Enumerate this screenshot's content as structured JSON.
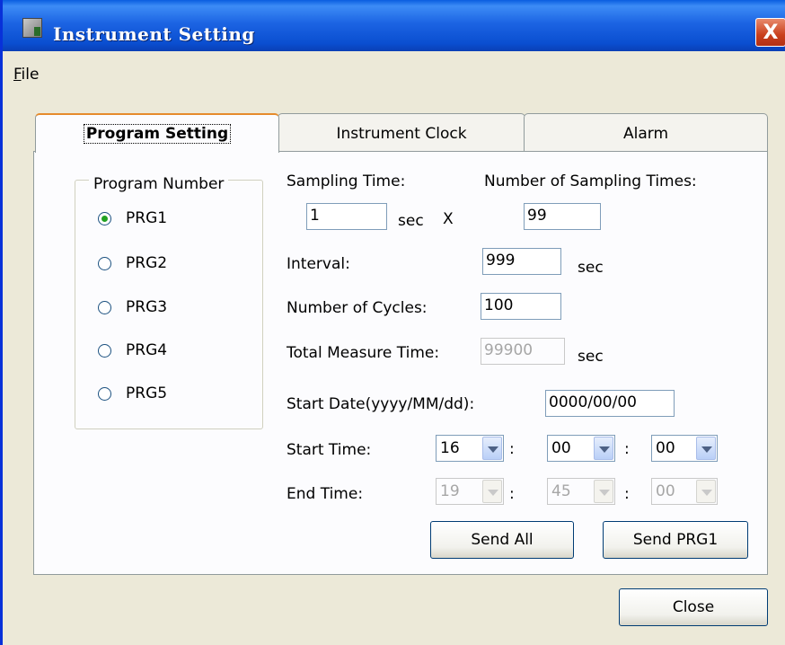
{
  "window": {
    "title": "Instrument Setting",
    "close_glyph": "X"
  },
  "menu": {
    "file_hotkey": "F",
    "file_rest": "ile"
  },
  "tabs": [
    {
      "label": "Program Setting"
    },
    {
      "label": "Instrument Clock"
    },
    {
      "label": "Alarm"
    }
  ],
  "program_group": {
    "label": "Program Number",
    "options": [
      "PRG1",
      "PRG2",
      "PRG3",
      "PRG4",
      "PRG5"
    ],
    "selected": "PRG1"
  },
  "form": {
    "sampling_time_label": "Sampling Time:",
    "sampling_time_value": "1",
    "sampling_time_unit": "sec",
    "times_symbol": "X",
    "num_sampling_label": "Number of Sampling Times:",
    "num_sampling_value": "99",
    "interval_label": "Interval:",
    "interval_value": "999",
    "interval_unit": "sec",
    "cycles_label": "Number of Cycles:",
    "cycles_value": "100",
    "total_label": "Total Measure Time:",
    "total_value": "99900",
    "total_unit": "sec",
    "start_date_label": "Start Date(yyyy/MM/dd):",
    "start_date_value": "0000/00/00",
    "start_time_label": "Start Time:",
    "start_time": {
      "hour": "16",
      "minute": "00",
      "second": "00"
    },
    "end_time_label": "End Time:",
    "end_time": {
      "hour": "19",
      "minute": "45",
      "second": "00"
    },
    "colon": ":"
  },
  "buttons": {
    "send_all": "Send All",
    "send_prg": "Send PRG1",
    "close": "Close"
  },
  "colors": {
    "titlebar": "#0a4ed0",
    "face": "#ece9d8",
    "panel": "#fcfcfe",
    "active_tab_accent": "#e68b2c"
  }
}
